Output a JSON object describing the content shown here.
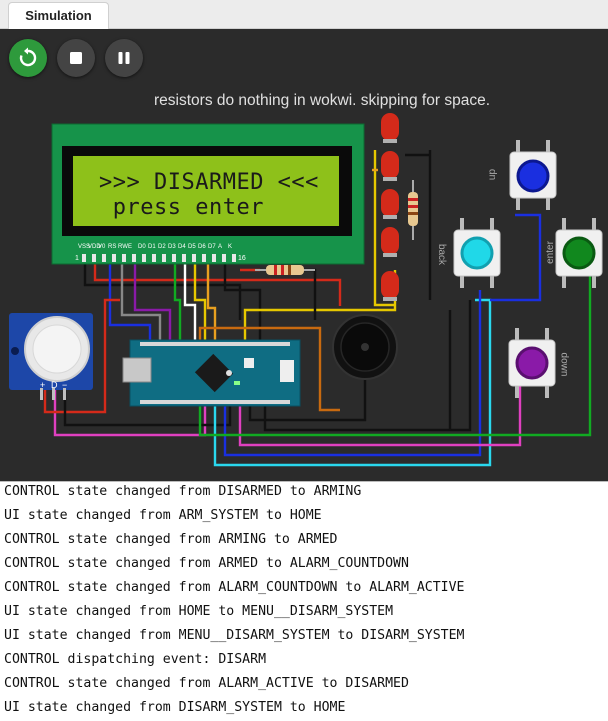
{
  "tabs": [
    {
      "label": "Simulation"
    }
  ],
  "controls": {
    "restart": {
      "icon": "restart-icon",
      "color": "#2e9a3c"
    },
    "stop": {
      "icon": "stop-icon",
      "color": "#444444"
    },
    "pause": {
      "icon": "pause-icon",
      "color": "#444444"
    }
  },
  "canvas": {
    "note": "resistors do nothing in wokwi. skipping for space.",
    "lcd": {
      "line1": ">>> DISARMED <<<",
      "line2": " press enter"
    },
    "lcd_pin_labels": [
      "VSS",
      "VDD",
      "V0",
      "RS",
      "RW",
      "E",
      "D0",
      "D1",
      "D2",
      "D3",
      "D4",
      "D5",
      "D6",
      "D7",
      "A",
      "K"
    ],
    "lcd_pin_numbers": [
      "1",
      "16"
    ],
    "button_labels": {
      "up": "up",
      "back": "back",
      "enter": "enter",
      "down": "down"
    },
    "button_colors": {
      "up": "#1a2fe0",
      "back": "#20d8e8",
      "enter": "#11881e",
      "down": "#8a1aa8"
    },
    "led_color": "#d42a1a",
    "pir_labels": [
      "+",
      "D",
      "−"
    ]
  },
  "console": {
    "lines": [
      "CONTROL state changed from DISARMED to ARMING",
      "UI state changed from ARM_SYSTEM to HOME",
      "CONTROL state changed from ARMING to ARMED",
      "CONTROL state changed from ARMED to ALARM_COUNTDOWN",
      "CONTROL state changed from ALARM_COUNTDOWN to ALARM_ACTIVE",
      "UI state changed from HOME to MENU__DISARM_SYSTEM",
      "UI state changed from MENU__DISARM_SYSTEM to DISARM_SYSTEM",
      "CONTROL dispatching event: DISARM",
      "CONTROL state changed from ALARM_ACTIVE to DISARMED",
      "UI state changed from DISARM_SYSTEM to HOME"
    ]
  }
}
